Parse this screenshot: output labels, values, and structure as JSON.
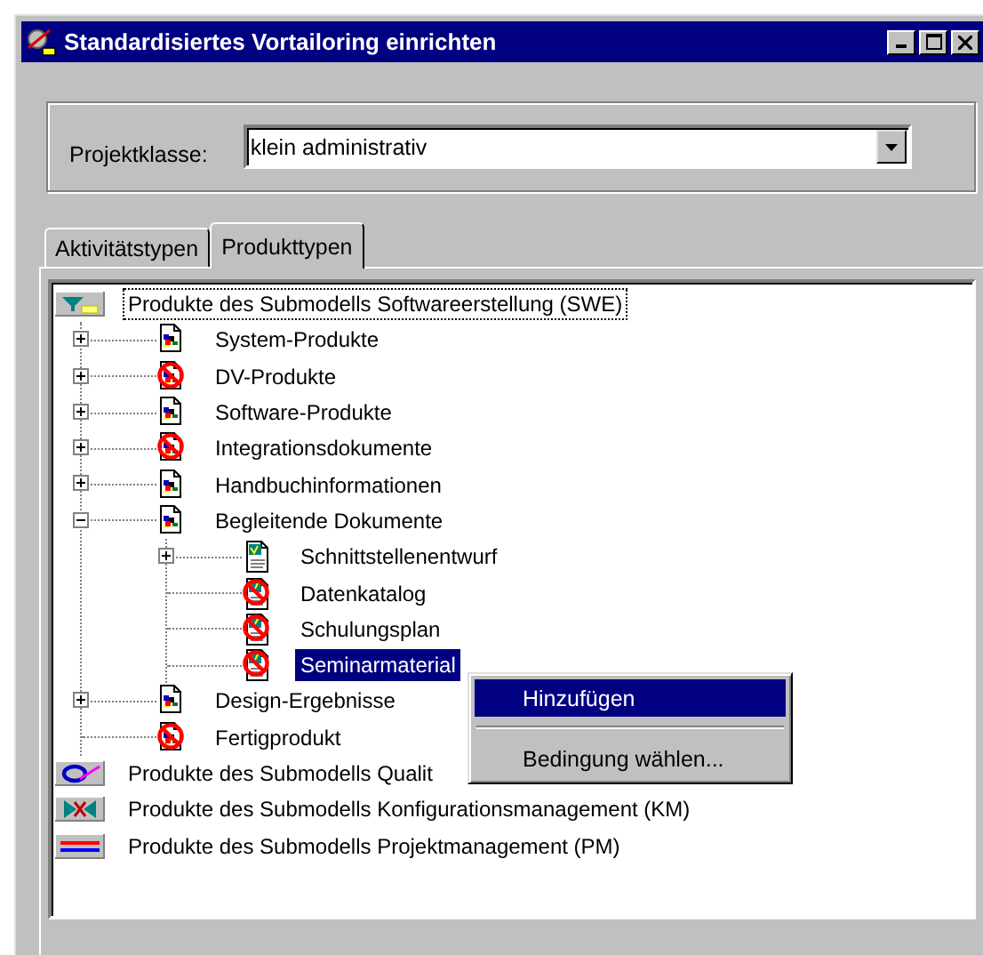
{
  "window": {
    "title": "Standardisiertes Vortailoring einrichten"
  },
  "project_class": {
    "label": "Projektklasse:",
    "value": "klein administrativ"
  },
  "tabs": [
    {
      "label": "Aktivitätstypen",
      "selected": false
    },
    {
      "label": "Produkttypen",
      "selected": true
    }
  ],
  "tree": [
    {
      "label": "Produkte des Submodells Softwareerstellung (SWE)",
      "kind": "swe",
      "focused": true,
      "selected": false,
      "children": [
        {
          "label": "System-Produkte",
          "kind": "doc",
          "excluded": false,
          "expanded": false,
          "selected": false
        },
        {
          "label": "DV-Produkte",
          "kind": "doc",
          "excluded": true,
          "expanded": false,
          "selected": false
        },
        {
          "label": "Software-Produkte",
          "kind": "doc",
          "excluded": false,
          "expanded": false,
          "selected": false
        },
        {
          "label": "Integrationsdokumente",
          "kind": "doc",
          "excluded": true,
          "expanded": false,
          "selected": false
        },
        {
          "label": "Handbuchinformationen",
          "kind": "doc",
          "excluded": false,
          "expanded": false,
          "selected": false
        },
        {
          "label": "Begleitende Dokumente",
          "kind": "doc",
          "excluded": false,
          "expanded": true,
          "selected": false,
          "children": [
            {
              "label": "Schnittstellenentwurf",
              "kind": "form",
              "excluded": false,
              "expanded": false,
              "selected": false
            },
            {
              "label": "Datenkatalog",
              "kind": "form",
              "excluded": true,
              "selected": false
            },
            {
              "label": "Schulungsplan",
              "kind": "form",
              "excluded": true,
              "selected": false
            },
            {
              "label": "Seminarmaterial",
              "kind": "form",
              "excluded": true,
              "selected": true
            }
          ]
        },
        {
          "label": "Design-Ergebnisse",
          "kind": "doc",
          "excluded": false,
          "expanded": false,
          "selected": false
        },
        {
          "label": "Fertigprodukt",
          "kind": "doc",
          "excluded": true,
          "selected": false
        }
      ]
    },
    {
      "label": "Produkte des Submodells Qualit",
      "kind": "qs",
      "focused": false,
      "selected": false
    },
    {
      "label": "Produkte des Submodells Konfigurationsmanagement (KM)",
      "kind": "km",
      "focused": false,
      "selected": false
    },
    {
      "label": "Produkte des Submodells Projektmanagement (PM)",
      "kind": "pm",
      "focused": false,
      "selected": false
    }
  ],
  "context_menu": {
    "items": [
      {
        "kind": "item",
        "label": "Hinzufügen",
        "selected": true
      },
      {
        "kind": "separator"
      },
      {
        "kind": "item",
        "label": "Bedingung wählen...",
        "selected": false
      }
    ]
  }
}
